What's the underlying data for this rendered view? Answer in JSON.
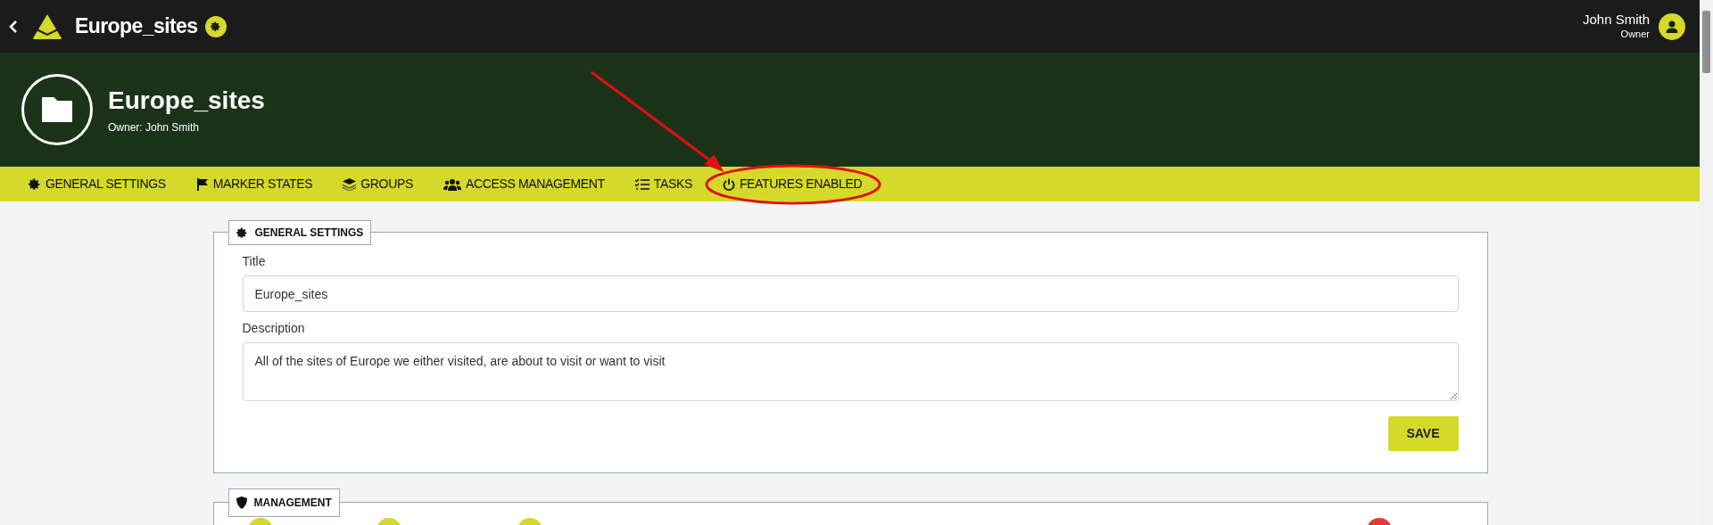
{
  "top_bar": {
    "title": "Europe_sites",
    "user_name": "John Smith",
    "user_role": "Owner"
  },
  "header": {
    "title": "Europe_sites",
    "subtitle": "Owner: John Smith"
  },
  "tabs": [
    {
      "label": "GENERAL SETTINGS",
      "kind": "gear",
      "selected": false
    },
    {
      "label": "MARKER STATES",
      "kind": "flag",
      "selected": false
    },
    {
      "label": "GROUPS",
      "kind": "layers",
      "selected": false
    },
    {
      "label": "ACCESS MANAGEMENT",
      "kind": "users",
      "selected": false
    },
    {
      "label": "TASKS",
      "kind": "tasks",
      "selected": false
    },
    {
      "label": "FEATURES ENABLED",
      "kind": "power",
      "selected": false
    }
  ],
  "general_settings": {
    "heading": "GENERAL SETTINGS",
    "fields": [
      {
        "label": "Title",
        "value": "Europe_sites",
        "kind": "input"
      },
      {
        "label": "Description",
        "value": "All of the sites of Europe we either visited, are about to visit or want to visit",
        "kind": "textarea"
      }
    ],
    "save_button": "SAVE"
  },
  "management": {
    "heading": "MANAGEMENT",
    "items": [
      {
        "color": "#d4d92a"
      },
      {
        "color": "#d4d92a"
      },
      {
        "color": "#d4d92a"
      },
      {
        "color": "#e53935"
      }
    ]
  }
}
